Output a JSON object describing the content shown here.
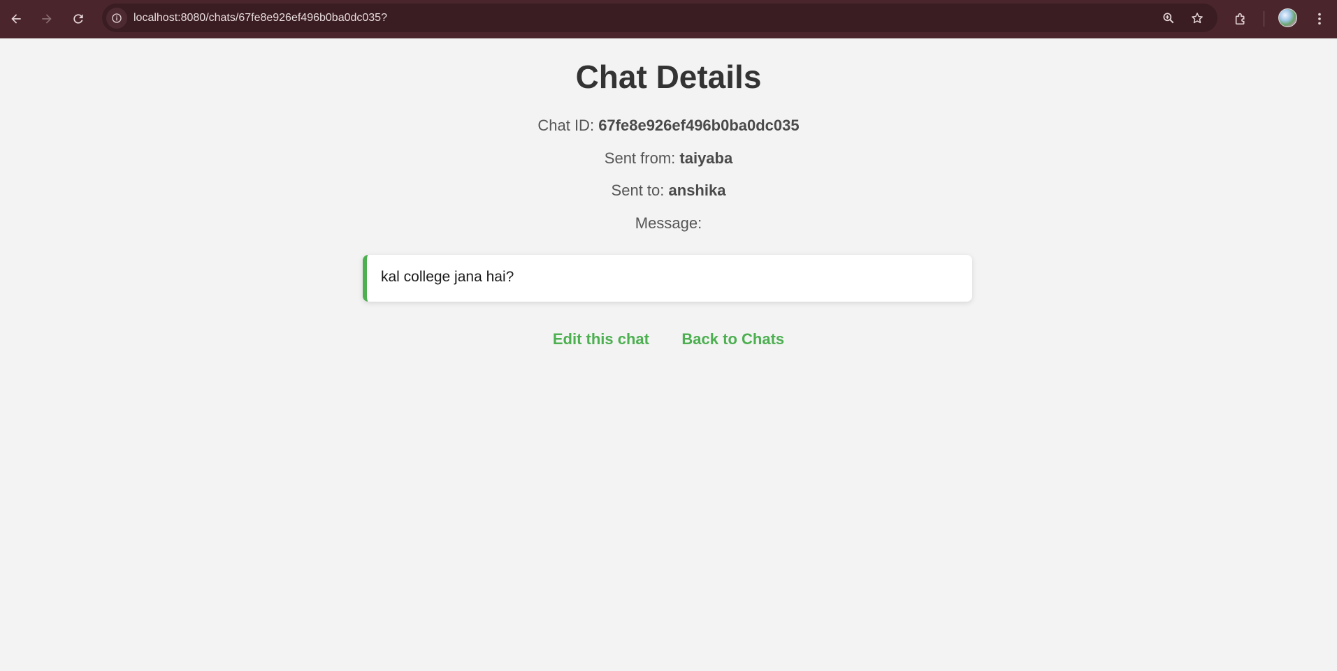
{
  "browser": {
    "url": "localhost:8080/chats/67fe8e926ef496b0ba0dc035?"
  },
  "page": {
    "title": "Chat Details",
    "chat_id_label": "Chat ID:",
    "chat_id": "67fe8e926ef496b0ba0dc035",
    "from_label": "Sent from:",
    "from": "taiyaba",
    "to_label": "Sent to:",
    "to": "anshika",
    "message_label": "Message:",
    "message": "kal college jana hai?",
    "edit_link": "Edit this chat",
    "back_link": "Back to Chats"
  },
  "colors": {
    "accent": "#4caf50",
    "browser_frame": "#4a252c",
    "background": "#f3f3f3"
  },
  "icons": [
    "back-arrow-icon",
    "forward-arrow-icon",
    "reload-icon",
    "info-icon",
    "zoom-icon",
    "star-icon",
    "extensions-icon",
    "menu-dots-icon"
  ]
}
